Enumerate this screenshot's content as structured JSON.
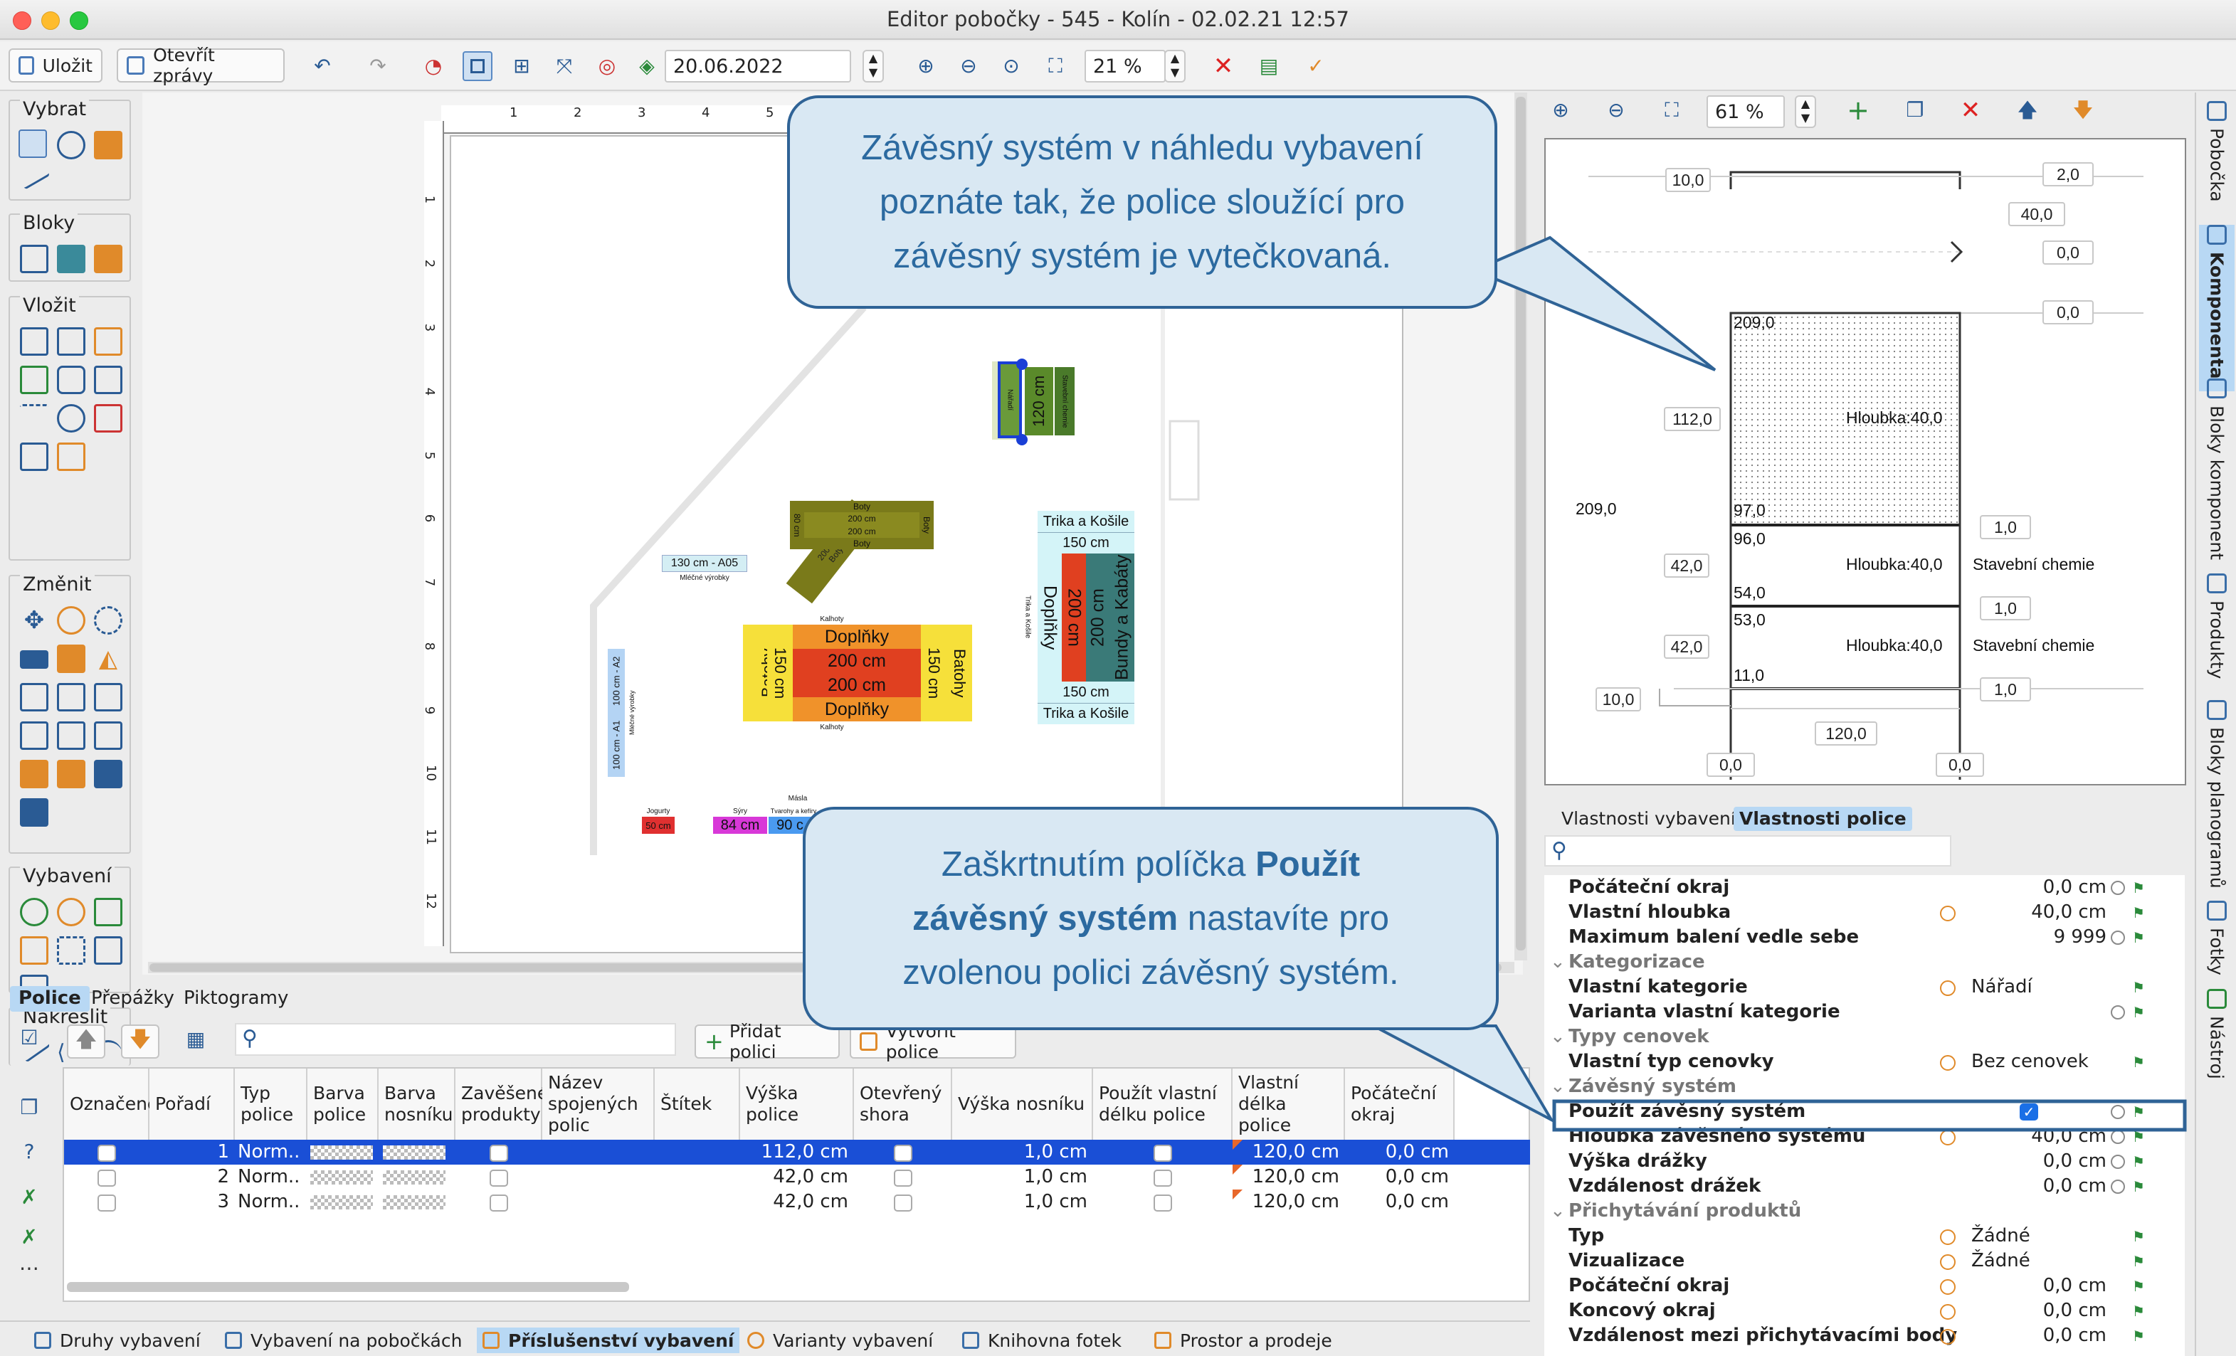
{
  "window": {
    "title": "Editor pobočky - 545 - Kolín - 02.02.21 12:57"
  },
  "toolbar": {
    "save": "Uložit",
    "open_reports": "Otevřít zprávy",
    "date": "20.06.2022",
    "zoom": "21 %"
  },
  "palette": {
    "select": "Vybrat",
    "blocks": "Bloky",
    "insert": "Vložit",
    "change": "Změnit",
    "equipment": "Vybavení",
    "draw": "Nakreslit"
  },
  "ruler": {
    "h": [
      "1",
      "2",
      "3",
      "4",
      "5"
    ],
    "v": [
      "1",
      "2",
      "3",
      "4",
      "5",
      "6",
      "7",
      "8",
      "9",
      "10",
      "11",
      "12"
    ]
  },
  "floorplan": {
    "boty_diag": "200 cm\nBoty",
    "stavebni_small": "Stavební chemie",
    "naradi": "Nářadí",
    "cm120": "120 cm",
    "stavebni_right": "Stavební chemie",
    "boty_top": "Boty",
    "boty_200a": "200 cm",
    "boty_200b": "200 cm",
    "boty_bottom": "Boty",
    "boty_side": "Boty",
    "cm80": "80 cm",
    "a05": "130 cm - A05",
    "mlecne": "Mléčné výrobky",
    "kalhoty_top": "Kalhoty",
    "doplnky_a": "Doplňky",
    "cm200_a": "200 cm",
    "cm200_b": "200 cm",
    "doplnky_b": "Doplňky",
    "kalhoty_bottom": "Kalhoty",
    "batohy": "Batohy",
    "cm150": "150 cm",
    "trika_top": "Trika a Košile",
    "cm150_top": "150 cm",
    "doplnky_v": "Doplňky",
    "cm200_v": "200 cm",
    "cm200_v2": "200 cm",
    "bundy": "Bundy a Kabáty",
    "cm150_bottom": "150 cm",
    "trika_bottom": "Trika a Košile",
    "trika_side": "Trika a Košile",
    "a2": "100 cm - A2",
    "a1": "100 cm - A1",
    "mlecne_v": "Mléčné výrobky",
    "jogurty": "Jogurty",
    "cm50": "50 cm",
    "syry": "Sýry",
    "cm84": "84 cm",
    "tvarohy": "Tvarohy a kefíry",
    "cm90": "90 c",
    "masla": "Másla"
  },
  "preview_toolbar": {
    "zoom": "61 %"
  },
  "preview": {
    "d_10a": "10,0",
    "d_2": "2,0",
    "d_40": "40,0",
    "d_0a": "0,0",
    "d_0b": "0,0",
    "d_209a": "209,0",
    "d_112": "112,0",
    "hloubka1": "Hloubka:40,0",
    "d_209b": "209,0",
    "d_97": "97,0",
    "d_96": "96,0",
    "d_1a": "1,0",
    "d_42a": "42,0",
    "hloubka2": "Hloubka:40,0",
    "chem1": "Stavební chemie",
    "d_54": "54,0",
    "d_53": "53,0",
    "d_1b": "1,0",
    "d_42b": "42,0",
    "hloubka3": "Hloubka:40,0",
    "chem2": "Stavební chemie",
    "d_11": "11,0",
    "d_1c": "1,0",
    "d_10b": "10,0",
    "d_120": "120,0",
    "d_0c": "0,0",
    "d_0d": "0,0"
  },
  "prop_tabs": {
    "equipment": "Vlastnosti vybavení",
    "shelf": "Vlastnosti police"
  },
  "props": [
    {
      "type": "row",
      "name": "Počáteční okraj",
      "value": "0,0 cm"
    },
    {
      "type": "row",
      "name": "Vlastní hloubka",
      "value": "40,0 cm"
    },
    {
      "type": "row",
      "name": "Maximum balení vedle sebe",
      "value": "9 999"
    },
    {
      "type": "header",
      "name": "Kategorizace"
    },
    {
      "type": "row",
      "name": "Vlastní kategorie",
      "value": "Nářadí"
    },
    {
      "type": "row",
      "name": "Varianta vlastní kategorie",
      "value": ""
    },
    {
      "type": "header",
      "name": "Typy cenovek"
    },
    {
      "type": "row",
      "name": "Vlastní typ cenovky",
      "value": "Bez cenovek"
    },
    {
      "type": "header",
      "name": "Závěsný systém"
    },
    {
      "type": "row",
      "name": "Použít závěsný systém",
      "value": ""
    },
    {
      "type": "row",
      "name": "Hloubka závěsného systému",
      "value": "40,0 cm"
    },
    {
      "type": "row",
      "name": "Výška drážky",
      "value": "0,0 cm"
    },
    {
      "type": "row",
      "name": "Vzdálenost drážek",
      "value": "0,0 cm"
    },
    {
      "type": "header",
      "name": "Přichytávání produktů"
    },
    {
      "type": "row",
      "name": "Typ",
      "value": "Žádné"
    },
    {
      "type": "row",
      "name": "Vizualizace",
      "value": "Žádné"
    },
    {
      "type": "row",
      "name": "Počáteční okraj",
      "value": "0,0 cm"
    },
    {
      "type": "row",
      "name": "Koncový okraj",
      "value": "0,0 cm"
    },
    {
      "type": "row",
      "name": "Vzdálenost mezi přichytávacími body",
      "value": "0,0 cm"
    }
  ],
  "vertical_tabs": [
    "Pobočka",
    "Komponenta",
    "Bloky komponent",
    "Produkty",
    "Bloky planogramů",
    "Fotky",
    "Nástroj"
  ],
  "bottom_tabs": [
    "Police",
    "Přepážky",
    "Piktogramy"
  ],
  "table_toolbar": {
    "add_shelf": "Přidat polici",
    "create_shelf": "Vytvořit police"
  },
  "table": {
    "columns": [
      "Označené",
      "Pořadí",
      "Typ police",
      "Barva police",
      "Barva nosníku",
      "Zavěšené produkty",
      "Název spojených polic",
      "Štítek",
      "Výška police",
      "Otevřený shora",
      "Výška nosníku",
      "Použít vlastní délku police",
      "Vlastní délka police",
      "Počáteční okraj"
    ],
    "rows": [
      {
        "order": "1",
        "type": "Norm...",
        "height": "112,0 cm",
        "beam": "1,0 cm",
        "length": "120,0 cm",
        "margin": "0,0 cm"
      },
      {
        "order": "2",
        "type": "Norm...",
        "height": "42,0 cm",
        "beam": "1,0 cm",
        "length": "120,0 cm",
        "margin": "0,0 cm"
      },
      {
        "order": "3",
        "type": "Norm...",
        "height": "42,0 cm",
        "beam": "1,0 cm",
        "length": "120,0 cm",
        "margin": "0,0 cm"
      }
    ]
  },
  "status_tabs": [
    "Druhy vybavení",
    "Vybavení na pobočkách",
    "Příslušenství vybavení",
    "Varianty vybavení",
    "Knihovna fotek",
    "Prostor a prodeje"
  ],
  "callouts": {
    "top": [
      "Závěsný systém v náhledu vybavení",
      "poznáte tak, že police sloužící pro",
      "závěsný systém je vytečkovaná."
    ],
    "bottom_pre": "Zaškrtnutím políčka ",
    "bottom_bold1": "Použít",
    "bottom_bold2": "závěsný systém",
    "bottom_post": " nastavíte pro",
    "bottom_line3": "zvolenou polici závěsný systém."
  },
  "colors": {
    "accent": "#2f6396",
    "selection": "#1a4fd6",
    "callout_bg": "#d9e8f3"
  }
}
